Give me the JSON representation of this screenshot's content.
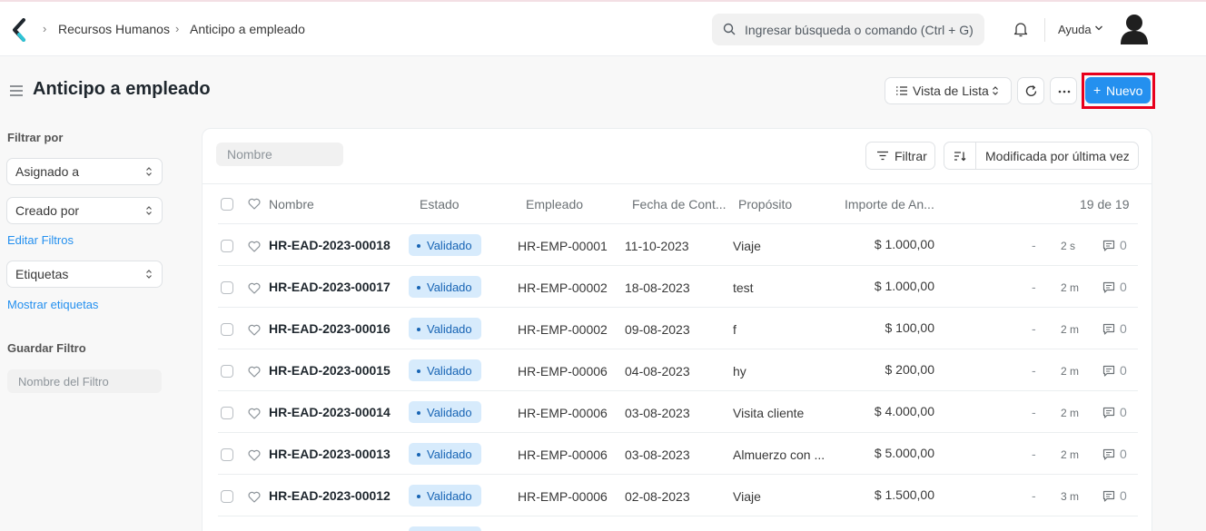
{
  "breadcrumb": [
    "Recursos Humanos",
    "Anticipo a empleado"
  ],
  "search": {
    "placeholder": "Ingresar búsqueda o comando (Ctrl + G)"
  },
  "help_label": "Ayuda",
  "page": {
    "title": "Anticipo a empleado"
  },
  "toolbar": {
    "view_label": "Vista de Lista",
    "new_label": "Nuevo"
  },
  "sidebar": {
    "filter_by": "Filtrar por",
    "assigned_to": "Asignado a",
    "created_by": "Creado por",
    "edit_filters": "Editar Filtros",
    "tags": "Etiquetas",
    "show_tags": "Mostrar etiquetas",
    "save_filter": "Guardar Filtro",
    "filter_name_placeholder": "Nombre del Filtro"
  },
  "list": {
    "name_placeholder": "Nombre",
    "filter_label": "Filtrar",
    "sort_label": "Modificada por última vez",
    "columns": [
      "Nombre",
      "Estado",
      "Empleado",
      "Fecha de Cont...",
      "Propósito",
      "Importe de An..."
    ],
    "count": "19 de 19",
    "rows": [
      {
        "id": "HR-EAD-2023-00018",
        "status": "Validado",
        "employee": "HR-EMP-00001",
        "date": "11-10-2023",
        "purpose": "Viaje",
        "amount": "$ 1.000,00",
        "dash": "-",
        "time": "2 s",
        "comments": "0"
      },
      {
        "id": "HR-EAD-2023-00017",
        "status": "Validado",
        "employee": "HR-EMP-00002",
        "date": "18-08-2023",
        "purpose": "test",
        "amount": "$ 1.000,00",
        "dash": "-",
        "time": "2 m",
        "comments": "0"
      },
      {
        "id": "HR-EAD-2023-00016",
        "status": "Validado",
        "employee": "HR-EMP-00002",
        "date": "09-08-2023",
        "purpose": "f",
        "amount": "$ 100,00",
        "dash": "-",
        "time": "2 m",
        "comments": "0"
      },
      {
        "id": "HR-EAD-2023-00015",
        "status": "Validado",
        "employee": "HR-EMP-00006",
        "date": "04-08-2023",
        "purpose": "hy",
        "amount": "$ 200,00",
        "dash": "-",
        "time": "2 m",
        "comments": "0"
      },
      {
        "id": "HR-EAD-2023-00014",
        "status": "Validado",
        "employee": "HR-EMP-00006",
        "date": "03-08-2023",
        "purpose": "Visita cliente",
        "amount": "$ 4.000,00",
        "dash": "-",
        "time": "2 m",
        "comments": "0"
      },
      {
        "id": "HR-EAD-2023-00013",
        "status": "Validado",
        "employee": "HR-EMP-00006",
        "date": "03-08-2023",
        "purpose": "Almuerzo con ...",
        "amount": "$ 5.000,00",
        "dash": "-",
        "time": "2 m",
        "comments": "0"
      },
      {
        "id": "HR-EAD-2023-00012",
        "status": "Validado",
        "employee": "HR-EMP-00006",
        "date": "02-08-2023",
        "purpose": "Viaje",
        "amount": "$ 1.500,00",
        "dash": "-",
        "time": "3 m",
        "comments": "0"
      }
    ]
  },
  "colors": {
    "accent": "#2490ef",
    "highlight": "#e8001c",
    "badge_bg": "#d7ebfc"
  }
}
